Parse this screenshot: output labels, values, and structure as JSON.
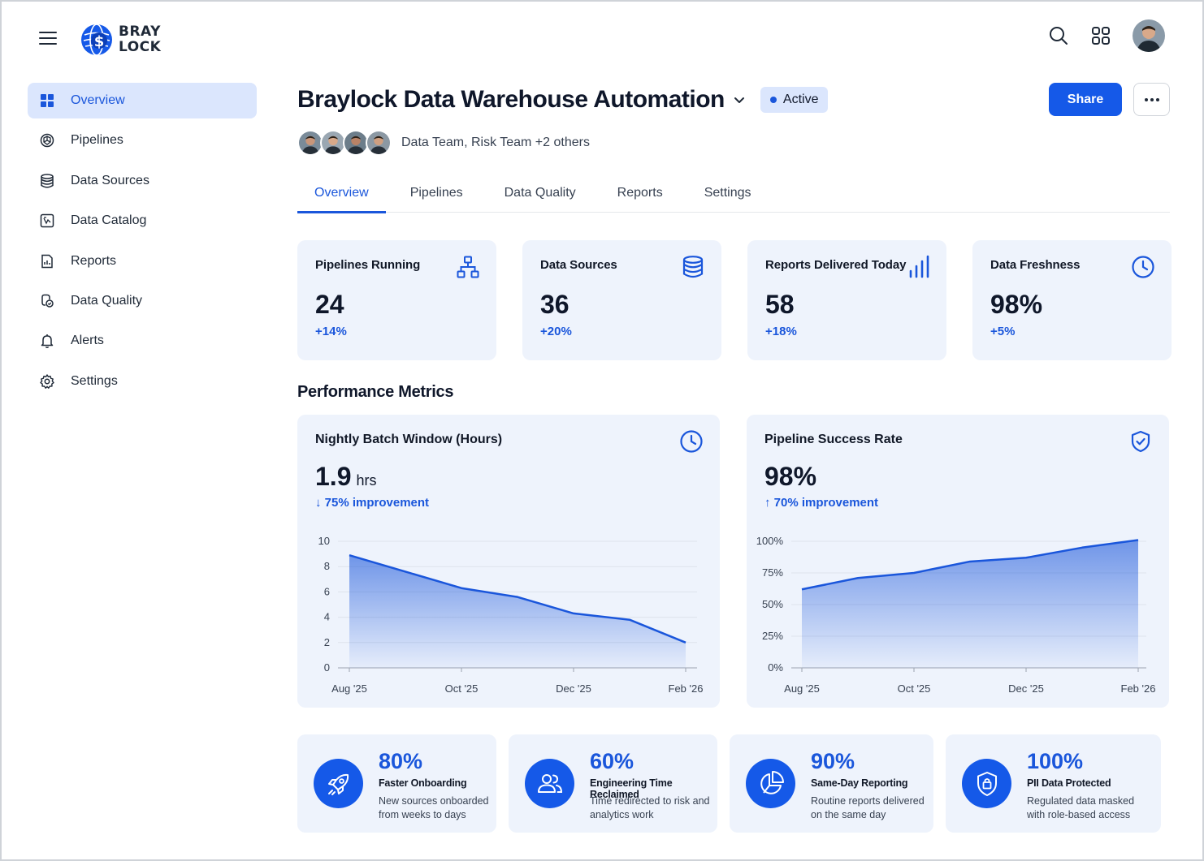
{
  "brand": {
    "line1": "BRAY",
    "line2": "LOCK"
  },
  "sidebar": {
    "items": [
      {
        "label": "Overview",
        "icon": "grid-icon",
        "active": true
      },
      {
        "label": "Pipelines",
        "icon": "pipeline-icon"
      },
      {
        "label": "Data Sources",
        "icon": "database-icon"
      },
      {
        "label": "Data Catalog",
        "icon": "catalog-icon"
      },
      {
        "label": "Reports",
        "icon": "report-icon"
      },
      {
        "label": "Data Quality",
        "icon": "quality-icon"
      },
      {
        "label": "Alerts",
        "icon": "bell-icon"
      },
      {
        "label": "Settings",
        "icon": "gear-icon"
      }
    ]
  },
  "header": {
    "title": "Braylock Data Warehouse Automation",
    "status": "Active",
    "share_label": "Share",
    "team_text": "Data Team, Risk Team +2 others"
  },
  "tabs": [
    {
      "label": "Overview",
      "active": true
    },
    {
      "label": "Pipelines"
    },
    {
      "label": "Data Quality"
    },
    {
      "label": "Reports"
    },
    {
      "label": "Settings"
    }
  ],
  "kpis": [
    {
      "label": "Pipelines Running",
      "value": "24",
      "delta": "+14%",
      "icon": "hierarchy-icon"
    },
    {
      "label": "Data Sources",
      "value": "36",
      "delta": "+20%",
      "icon": "database-icon"
    },
    {
      "label": "Reports Delivered Today",
      "value": "58",
      "delta": "+18%",
      "icon": "bar-chart-icon"
    },
    {
      "label": "Data Freshness",
      "value": "98%",
      "delta": "+5%",
      "icon": "clock-icon"
    }
  ],
  "section_title": "Performance Metrics",
  "metrics": {
    "batch": {
      "title": "Nightly Batch Window (Hours)",
      "value": "1.9",
      "unit": "hrs",
      "delta": "↓ 75% improvement",
      "icon": "clock-icon"
    },
    "success": {
      "title": "Pipeline Success Rate",
      "value": "98%",
      "delta": "↑ 70% improvement",
      "icon": "shield-check-icon"
    }
  },
  "chart_data": [
    {
      "type": "area",
      "title": "Nightly Batch Window (Hours)",
      "x": [
        "Aug '25",
        "Sep '25",
        "Oct '25",
        "Nov '25",
        "Dec '25",
        "Jan '26",
        "Feb '26"
      ],
      "x_tick_labels": [
        "Aug '25",
        "Oct '25",
        "Dec '25",
        "Feb '26"
      ],
      "series": [
        {
          "values": [
            8.9,
            7.6,
            6.3,
            5.6,
            4.3,
            3.8,
            2.0
          ]
        }
      ],
      "y_ticks": [
        0,
        2,
        4,
        6,
        8,
        10
      ],
      "ylim": [
        0,
        10
      ],
      "grid": true,
      "color": "#1a56db"
    },
    {
      "type": "area",
      "title": "Pipeline Success Rate",
      "x": [
        "Aug '25",
        "Sep '25",
        "Oct '25",
        "Nov '25",
        "Dec '25",
        "Jan '26",
        "Feb '26"
      ],
      "x_tick_labels": [
        "Aug '25",
        "Oct '25",
        "Dec '25",
        "Feb '26"
      ],
      "series": [
        {
          "values": [
            62,
            71,
            75,
            84,
            87,
            95,
            101
          ]
        }
      ],
      "y_ticks": [
        "0%",
        "25%",
        "50%",
        "75%",
        "100%"
      ],
      "ylim": [
        0,
        100
      ],
      "grid": true,
      "color": "#1a56db"
    }
  ],
  "outcomes": [
    {
      "pct": "80%",
      "title": "Faster Onboarding",
      "desc": "New sources onboarded from weeks to days",
      "icon": "rocket-icon"
    },
    {
      "pct": "60%",
      "title": "Engineering Time Reclaimed",
      "desc": "Time redirected to risk and analytics work",
      "icon": "users-icon"
    },
    {
      "pct": "90%",
      "title": "Same-Day Reporting",
      "desc": "Routine reports delivered on the same day",
      "icon": "pie-chart-icon"
    },
    {
      "pct": "100%",
      "title": "PII Data Protected",
      "desc": "Regulated data masked with role-based access",
      "icon": "shield-lock-icon"
    }
  ]
}
